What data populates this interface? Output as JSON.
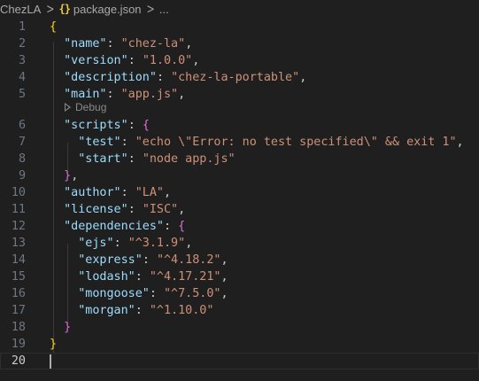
{
  "breadcrumb": {
    "folder": "ChezLA",
    "separator": ">",
    "file": "package.json",
    "file_icon": "json-braces-icon",
    "symbol_ellipsis": "..."
  },
  "codelens": {
    "label": "Debug",
    "icon": "play-icon"
  },
  "editor": {
    "active_line": 20,
    "line_numbers": [
      "1",
      "2",
      "3",
      "4",
      "5",
      "6",
      "7",
      "8",
      "9",
      "10",
      "11",
      "12",
      "13",
      "14",
      "15",
      "16",
      "17",
      "18",
      "19",
      "20"
    ],
    "lines": [
      [
        {
          "t": "{",
          "c": "b1"
        }
      ],
      [
        {
          "t": "  \"name\"",
          "c": "k"
        },
        {
          "t": ": ",
          "c": "p"
        },
        {
          "t": "\"chez-la\"",
          "c": "s"
        },
        {
          "t": ",",
          "c": "p"
        }
      ],
      [
        {
          "t": "  \"version\"",
          "c": "k"
        },
        {
          "t": ": ",
          "c": "p"
        },
        {
          "t": "\"1.0.0\"",
          "c": "s"
        },
        {
          "t": ",",
          "c": "p"
        }
      ],
      [
        {
          "t": "  \"description\"",
          "c": "k"
        },
        {
          "t": ": ",
          "c": "p"
        },
        {
          "t": "\"chez-la-portable\"",
          "c": "s"
        },
        {
          "t": ",",
          "c": "p"
        }
      ],
      [
        {
          "t": "  \"main\"",
          "c": "k"
        },
        {
          "t": ": ",
          "c": "p"
        },
        {
          "t": "\"app.js\"",
          "c": "s"
        },
        {
          "t": ",",
          "c": "p"
        }
      ],
      [
        {
          "t": "  \"scripts\"",
          "c": "k"
        },
        {
          "t": ": ",
          "c": "p"
        },
        {
          "t": "{",
          "c": "b2"
        }
      ],
      [
        {
          "t": "    \"test\"",
          "c": "k"
        },
        {
          "t": ": ",
          "c": "p"
        },
        {
          "t": "\"echo \\\"Error: no test specified\\\" && exit 1\"",
          "c": "s"
        },
        {
          "t": ",",
          "c": "p"
        }
      ],
      [
        {
          "t": "    \"start\"",
          "c": "k"
        },
        {
          "t": ": ",
          "c": "p"
        },
        {
          "t": "\"node app.js\"",
          "c": "s"
        }
      ],
      [
        {
          "t": "  }",
          "c": "b2"
        },
        {
          "t": ",",
          "c": "p"
        }
      ],
      [
        {
          "t": "  \"author\"",
          "c": "k"
        },
        {
          "t": ": ",
          "c": "p"
        },
        {
          "t": "\"LA\"",
          "c": "s"
        },
        {
          "t": ",",
          "c": "p"
        }
      ],
      [
        {
          "t": "  \"license\"",
          "c": "k"
        },
        {
          "t": ": ",
          "c": "p"
        },
        {
          "t": "\"ISC\"",
          "c": "s"
        },
        {
          "t": ",",
          "c": "p"
        }
      ],
      [
        {
          "t": "  \"dependencies\"",
          "c": "k"
        },
        {
          "t": ": ",
          "c": "p"
        },
        {
          "t": "{",
          "c": "b2"
        }
      ],
      [
        {
          "t": "    \"ejs\"",
          "c": "k"
        },
        {
          "t": ": ",
          "c": "p"
        },
        {
          "t": "\"^3.1.9\"",
          "c": "s"
        },
        {
          "t": ",",
          "c": "p"
        }
      ],
      [
        {
          "t": "    \"express\"",
          "c": "k"
        },
        {
          "t": ": ",
          "c": "p"
        },
        {
          "t": "\"^4.18.2\"",
          "c": "s"
        },
        {
          "t": ",",
          "c": "p"
        }
      ],
      [
        {
          "t": "    \"lodash\"",
          "c": "k"
        },
        {
          "t": ": ",
          "c": "p"
        },
        {
          "t": "\"^4.17.21\"",
          "c": "s"
        },
        {
          "t": ",",
          "c": "p"
        }
      ],
      [
        {
          "t": "    \"mongoose\"",
          "c": "k"
        },
        {
          "t": ": ",
          "c": "p"
        },
        {
          "t": "\"^7.5.0\"",
          "c": "s"
        },
        {
          "t": ",",
          "c": "p"
        }
      ],
      [
        {
          "t": "    \"morgan\"",
          "c": "k"
        },
        {
          "t": ": ",
          "c": "p"
        },
        {
          "t": "\"^1.10.0\"",
          "c": "s"
        }
      ],
      [
        {
          "t": "  }",
          "c": "b2"
        }
      ],
      [
        {
          "t": "}",
          "c": "b1"
        }
      ],
      []
    ]
  },
  "colors": {
    "background": "#1f1f1f",
    "key": "#9cdcfe",
    "string": "#ce9178",
    "bracket_level1": "#ffd700",
    "bracket_level2": "#da70d6",
    "line_number": "#6e7681"
  }
}
